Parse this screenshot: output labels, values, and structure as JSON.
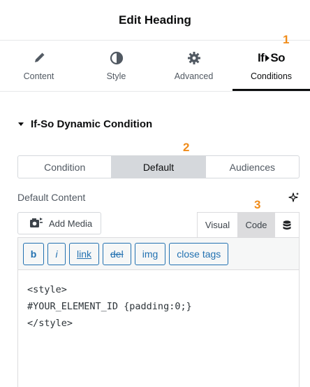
{
  "header": {
    "title": "Edit Heading"
  },
  "tabs": [
    {
      "label": "Content",
      "icon": "pencil-icon"
    },
    {
      "label": "Style",
      "icon": "half-circle-icon"
    },
    {
      "label": "Advanced",
      "icon": "gear-icon"
    },
    {
      "label": "Conditions",
      "icon": "ifso-logo",
      "logo_text_a": "If",
      "logo_text_b": "So",
      "active": true
    }
  ],
  "markers": [
    "1",
    "2",
    "3"
  ],
  "section": {
    "title": "If-So Dynamic Condition"
  },
  "segments": [
    {
      "label": "Condition"
    },
    {
      "label": "Default",
      "active": true
    },
    {
      "label": "Audiences"
    }
  ],
  "field": {
    "label": "Default Content"
  },
  "add_media": {
    "label": "Add Media"
  },
  "editor_modes": {
    "visual": "Visual",
    "code": "Code",
    "active": "Code"
  },
  "quicktags": [
    "b",
    "i",
    "link",
    "del",
    "img",
    "close tags"
  ],
  "code_lines": [
    "<style>",
    "#YOUR_ELEMENT_ID {padding:0;}",
    "</style>"
  ],
  "colors": {
    "marker": "#f08c1a",
    "quicktag": "#2271b1"
  }
}
